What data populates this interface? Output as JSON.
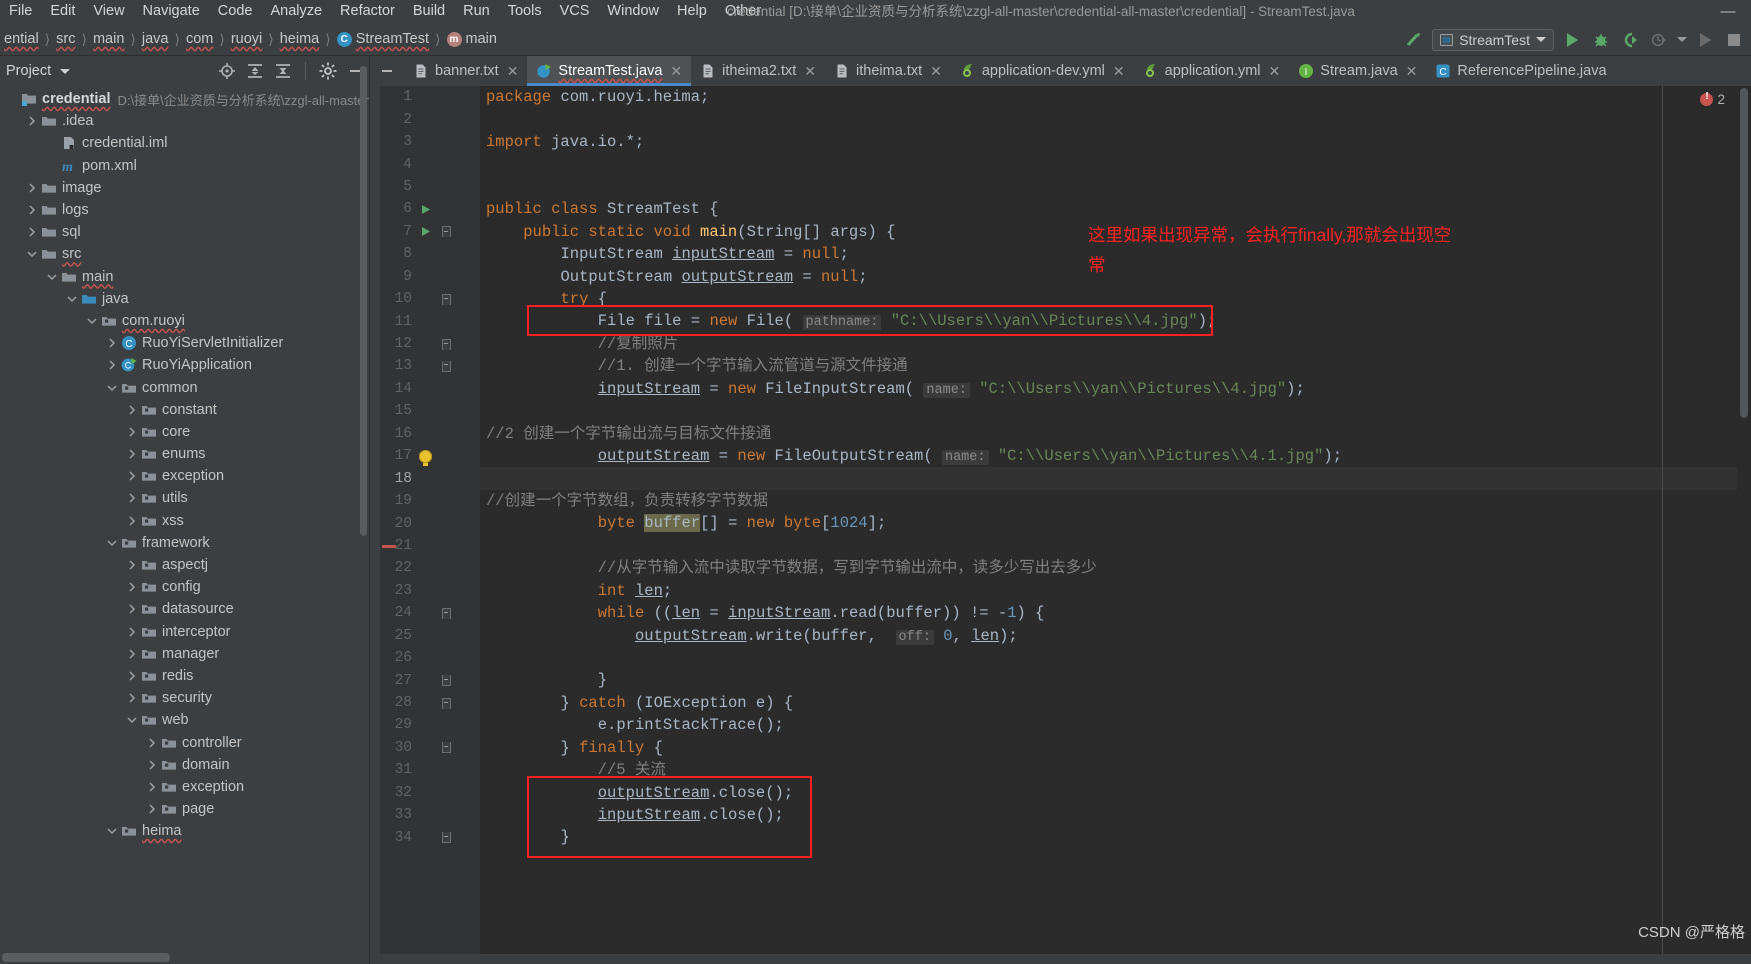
{
  "window": {
    "title": "credential [D:\\接单\\企业资质与分析系统\\zzgl-all-master\\credential-all-master\\credential] - StreamTest.java",
    "minimize_label": "—"
  },
  "menubar": {
    "items": [
      {
        "label": "File"
      },
      {
        "label": "Edit"
      },
      {
        "label": "View"
      },
      {
        "label": "Navigate"
      },
      {
        "label": "Code"
      },
      {
        "label": "Analyze"
      },
      {
        "label": "Refactor"
      },
      {
        "label": "Build"
      },
      {
        "label": "Run"
      },
      {
        "label": "Tools"
      },
      {
        "label": "VCS"
      },
      {
        "label": "Window"
      },
      {
        "label": "Help"
      },
      {
        "label": "Other"
      }
    ]
  },
  "breadcrumb": {
    "items": [
      "ential",
      "src",
      "main",
      "java",
      "com",
      "ruoyi",
      "heima",
      "StreamTest",
      "main"
    ]
  },
  "run_toolbar": {
    "config_name": "StreamTest",
    "buttons": [
      "build-icon",
      "run-button",
      "debug-button",
      "run-with-coverage-button",
      "profile-button",
      "rerun-button",
      "stop-button"
    ]
  },
  "project_panel": {
    "title": "Project",
    "actions": [
      "locate-icon",
      "expand-all-icon",
      "collapse-all-icon",
      "settings-gear-icon",
      "hide-icon"
    ],
    "tree": [
      {
        "label": "credential",
        "sub": "D:\\接单\\企业资质与分析系统\\zzgl-all-master",
        "depth": 0,
        "arrow": "none",
        "icon": "module-icon",
        "bold": true,
        "squiggle": true
      },
      {
        "label": ".idea",
        "depth": 1,
        "arrow": "right",
        "icon": "folder-icon"
      },
      {
        "label": "credential.iml",
        "depth": 2,
        "arrow": "none",
        "icon": "iml-icon"
      },
      {
        "label": "pom.xml",
        "depth": 2,
        "arrow": "none",
        "icon": "maven-icon"
      },
      {
        "label": "image",
        "depth": 1,
        "arrow": "right",
        "icon": "folder-icon"
      },
      {
        "label": "logs",
        "depth": 1,
        "arrow": "right",
        "icon": "folder-icon"
      },
      {
        "label": "sql",
        "depth": 1,
        "arrow": "right",
        "icon": "folder-icon"
      },
      {
        "label": "src",
        "depth": 1,
        "arrow": "down",
        "icon": "folder-icon",
        "squiggle": true
      },
      {
        "label": "main",
        "depth": 2,
        "arrow": "down",
        "icon": "folder-icon",
        "squiggle": true
      },
      {
        "label": "java",
        "depth": 3,
        "arrow": "down",
        "icon": "source-folder-icon"
      },
      {
        "label": "com.ruoyi",
        "depth": 4,
        "arrow": "down",
        "icon": "package-icon",
        "squiggle": true
      },
      {
        "label": "RuoYiServletInitializer",
        "depth": 5,
        "arrow": "right",
        "icon": "class-icon"
      },
      {
        "label": "RuoYiApplication",
        "depth": 5,
        "arrow": "right",
        "icon": "runnable-class-icon"
      },
      {
        "label": "common",
        "depth": 5,
        "arrow": "down",
        "icon": "package-icon"
      },
      {
        "label": "constant",
        "depth": 6,
        "arrow": "right",
        "icon": "package-icon"
      },
      {
        "label": "core",
        "depth": 6,
        "arrow": "right",
        "icon": "package-icon"
      },
      {
        "label": "enums",
        "depth": 6,
        "arrow": "right",
        "icon": "package-icon"
      },
      {
        "label": "exception",
        "depth": 6,
        "arrow": "right",
        "icon": "package-icon"
      },
      {
        "label": "utils",
        "depth": 6,
        "arrow": "right",
        "icon": "package-icon"
      },
      {
        "label": "xss",
        "depth": 6,
        "arrow": "right",
        "icon": "package-icon"
      },
      {
        "label": "framework",
        "depth": 5,
        "arrow": "down",
        "icon": "package-icon"
      },
      {
        "label": "aspectj",
        "depth": 6,
        "arrow": "right",
        "icon": "package-icon"
      },
      {
        "label": "config",
        "depth": 6,
        "arrow": "right",
        "icon": "package-icon"
      },
      {
        "label": "datasource",
        "depth": 6,
        "arrow": "right",
        "icon": "package-icon"
      },
      {
        "label": "interceptor",
        "depth": 6,
        "arrow": "right",
        "icon": "package-icon"
      },
      {
        "label": "manager",
        "depth": 6,
        "arrow": "right",
        "icon": "package-icon"
      },
      {
        "label": "redis",
        "depth": 6,
        "arrow": "right",
        "icon": "package-icon"
      },
      {
        "label": "security",
        "depth": 6,
        "arrow": "right",
        "icon": "package-icon"
      },
      {
        "label": "web",
        "depth": 6,
        "arrow": "down",
        "icon": "package-icon"
      },
      {
        "label": "controller",
        "depth": 7,
        "arrow": "right",
        "icon": "package-icon"
      },
      {
        "label": "domain",
        "depth": 7,
        "arrow": "right",
        "icon": "package-icon"
      },
      {
        "label": "exception",
        "depth": 7,
        "arrow": "right",
        "icon": "package-icon"
      },
      {
        "label": "page",
        "depth": 7,
        "arrow": "right",
        "icon": "package-icon"
      },
      {
        "label": "heima",
        "depth": 5,
        "arrow": "down",
        "icon": "package-icon",
        "squiggle": true
      }
    ]
  },
  "editor_tabs": [
    {
      "label": "banner.txt",
      "icon": "text-file-icon",
      "active": false,
      "closable": true
    },
    {
      "label": "StreamTest.java",
      "icon": "java-runnable-icon",
      "active": true,
      "closable": true
    },
    {
      "label": "itheima2.txt",
      "icon": "text-file-icon",
      "active": false,
      "closable": true
    },
    {
      "label": "itheima.txt",
      "icon": "text-file-icon",
      "active": false,
      "closable": true
    },
    {
      "label": "application-dev.yml",
      "icon": "yml-file-icon",
      "active": false,
      "closable": true
    },
    {
      "label": "application.yml",
      "icon": "yml-file-icon",
      "active": false,
      "closable": true
    },
    {
      "label": "Stream.java",
      "icon": "interface-icon",
      "active": false,
      "closable": true
    },
    {
      "label": "ReferencePipeline.java",
      "icon": "abstract-class-icon",
      "active": false,
      "closable": false
    }
  ],
  "editor": {
    "error_count": "2",
    "lines": [
      {
        "n": "1",
        "fold": "",
        "mark": ""
      },
      {
        "n": "2",
        "fold": "",
        "mark": ""
      },
      {
        "n": "3",
        "fold": "",
        "mark": ""
      },
      {
        "n": "4",
        "fold": "",
        "mark": ""
      },
      {
        "n": "5",
        "fold": "",
        "mark": ""
      },
      {
        "n": "6",
        "fold": "",
        "mark": "run"
      },
      {
        "n": "7",
        "fold": "down",
        "mark": "run"
      },
      {
        "n": "8",
        "fold": "",
        "mark": ""
      },
      {
        "n": "9",
        "fold": "",
        "mark": ""
      },
      {
        "n": "10",
        "fold": "down",
        "mark": ""
      },
      {
        "n": "11",
        "fold": "",
        "mark": ""
      },
      {
        "n": "12",
        "fold": "down",
        "mark": ""
      },
      {
        "n": "13",
        "fold": "up",
        "mark": ""
      },
      {
        "n": "14",
        "fold": "",
        "mark": ""
      },
      {
        "n": "15",
        "fold": "",
        "mark": ""
      },
      {
        "n": "16",
        "fold": "",
        "mark": ""
      },
      {
        "n": "17",
        "fold": "",
        "mark": "bulb"
      },
      {
        "n": "18",
        "fold": "",
        "mark": ""
      },
      {
        "n": "19",
        "fold": "",
        "mark": ""
      },
      {
        "n": "20",
        "fold": "",
        "mark": ""
      },
      {
        "n": "21",
        "fold": "",
        "mark": "red"
      },
      {
        "n": "22",
        "fold": "",
        "mark": ""
      },
      {
        "n": "23",
        "fold": "",
        "mark": ""
      },
      {
        "n": "24",
        "fold": "down",
        "mark": ""
      },
      {
        "n": "25",
        "fold": "",
        "mark": ""
      },
      {
        "n": "26",
        "fold": "",
        "mark": ""
      },
      {
        "n": "27",
        "fold": "up",
        "mark": ""
      },
      {
        "n": "28",
        "fold": "down",
        "mark": ""
      },
      {
        "n": "29",
        "fold": "",
        "mark": ""
      },
      {
        "n": "30",
        "fold": "up",
        "mark": ""
      },
      {
        "n": "31",
        "fold": "",
        "mark": ""
      },
      {
        "n": "32",
        "fold": "",
        "mark": ""
      },
      {
        "n": "33",
        "fold": "",
        "mark": ""
      },
      {
        "n": "34",
        "fold": "up",
        "mark": ""
      }
    ],
    "code_lines": [
      "package com.ruoyi.heima;",
      "",
      "import java.io.*;",
      "",
      "",
      "public class StreamTest {",
      "    public static void main(String[] args) {",
      "        InputStream inputStream = null;",
      "        OutputStream outputStream = null;",
      "        try {",
      "            File file = new File( pathname: \"C:\\\\Users\\\\yan\\\\Pictures\\\\4.jpg\");",
      "            //复制照片",
      "            //1. 创建一个字节输入流管道与源文件接通",
      "            inputStream = new FileInputStream( name: \"C:\\\\Users\\\\yan\\\\Pictures\\\\4.jpg\");",
      "",
      "//2 创建一个字节输出流与目标文件接通",
      "            outputStream = new FileOutputStream( name: \"C:\\\\Users\\\\yan\\\\Pictures\\\\4.1.jpg\");",
      "",
      "//创建一个字节数组，负责转移字节数据",
      "            byte buffer[] = new byte[1024];",
      "",
      "            //从字节输入流中读取字节数据，写到字节输出流中，读多少写出去多少",
      "            int len;",
      "            while ((len = inputStream.read(buffer)) != -1) {",
      "                outputStream.write(buffer,  off: 0, len);",
      "",
      "            }",
      "        } catch (IOException e) {",
      "            e.printStackTrace();",
      "        } finally {",
      "            //5 关流",
      "            outputStream.close();",
      "            inputStream.close();",
      "        }"
    ]
  },
  "annotations": {
    "red_note": "这里如果出现异常，会执行finally,那就会出现空\n常",
    "boxes": [
      "box-file-line",
      "box-finally-close"
    ]
  },
  "watermark": {
    "text": "CSDN @严格格"
  },
  "colors": {
    "accent_blue": "#4a88c7",
    "error_red": "#c75450",
    "annotation_red": "#ff2020",
    "string_green": "#6a8759",
    "keyword_orange": "#cc7832",
    "number_blue": "#6897bb",
    "comment_gray": "#808080",
    "panel_bg": "#3c3f41",
    "editor_bg": "#2b2b2b",
    "gutter_bg": "#313335"
  }
}
